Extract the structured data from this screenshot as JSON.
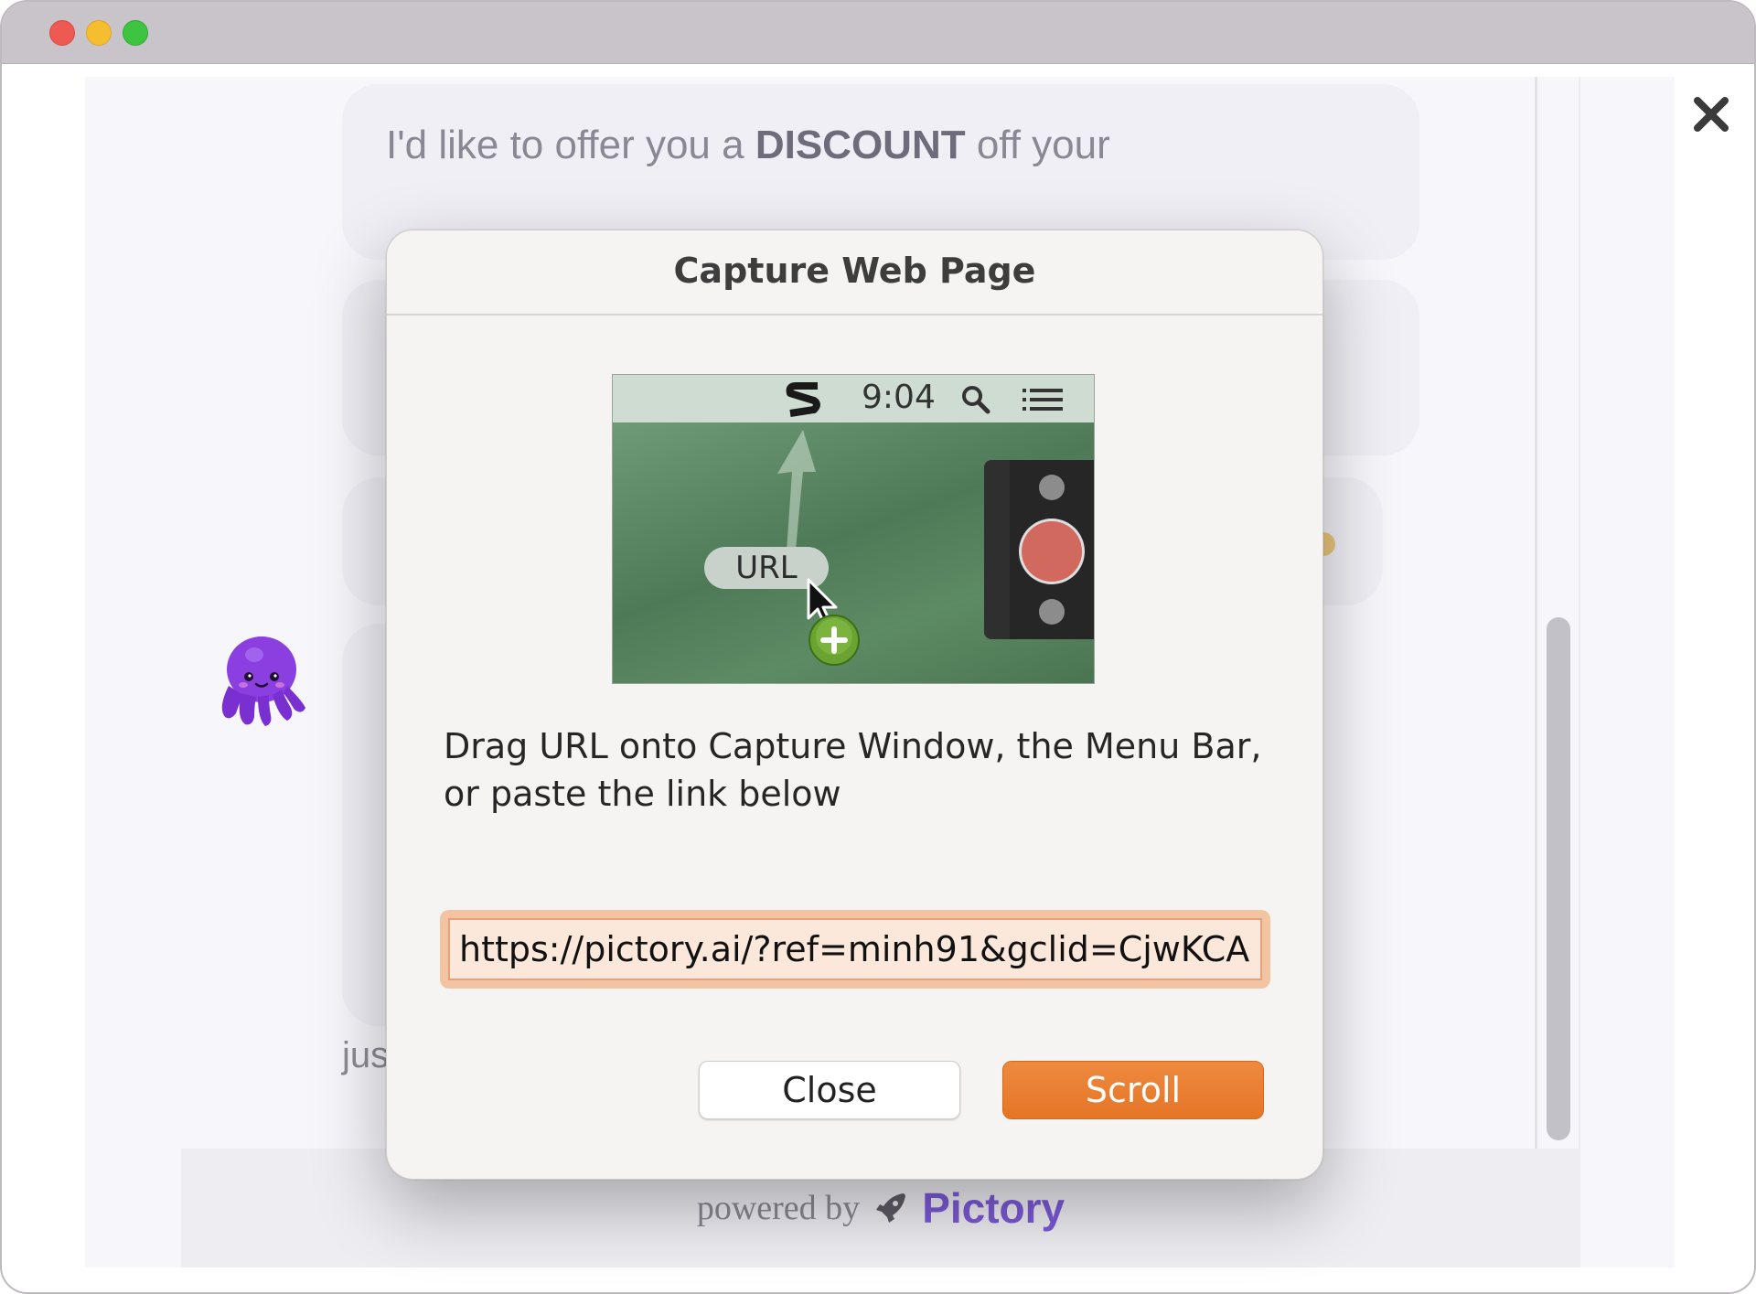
{
  "window": {
    "controls": [
      "close",
      "minimize",
      "zoom"
    ]
  },
  "chat": {
    "message_text_before": "I'd like to offer you a ",
    "message_text_bold": "DISCOUNT",
    "message_text_after": " off your",
    "partial_text": "jus",
    "footer_powered": "powered by",
    "footer_brand": "Pictory",
    "close_icon": "close-x-icon",
    "avatar_icon": "octopus-icon"
  },
  "dialog": {
    "title": "Capture Web Page",
    "illustration": {
      "menubar_time": "9:04",
      "url_pill_label": "URL",
      "menubar_icons": [
        "app-s-icon",
        "search-icon",
        "list-icon"
      ]
    },
    "instructions": "Drag URL onto Capture Window, the Menu Bar, or paste the link below",
    "url_value": "https://pictory.ai/?ref=minh91&gclid=CjwKCA",
    "close_label": "Close",
    "scroll_label": "Scroll"
  },
  "colors": {
    "accent_orange": "#e57526",
    "brand_purple": "#7b5ad6",
    "field_focus": "#f2c4a2"
  }
}
